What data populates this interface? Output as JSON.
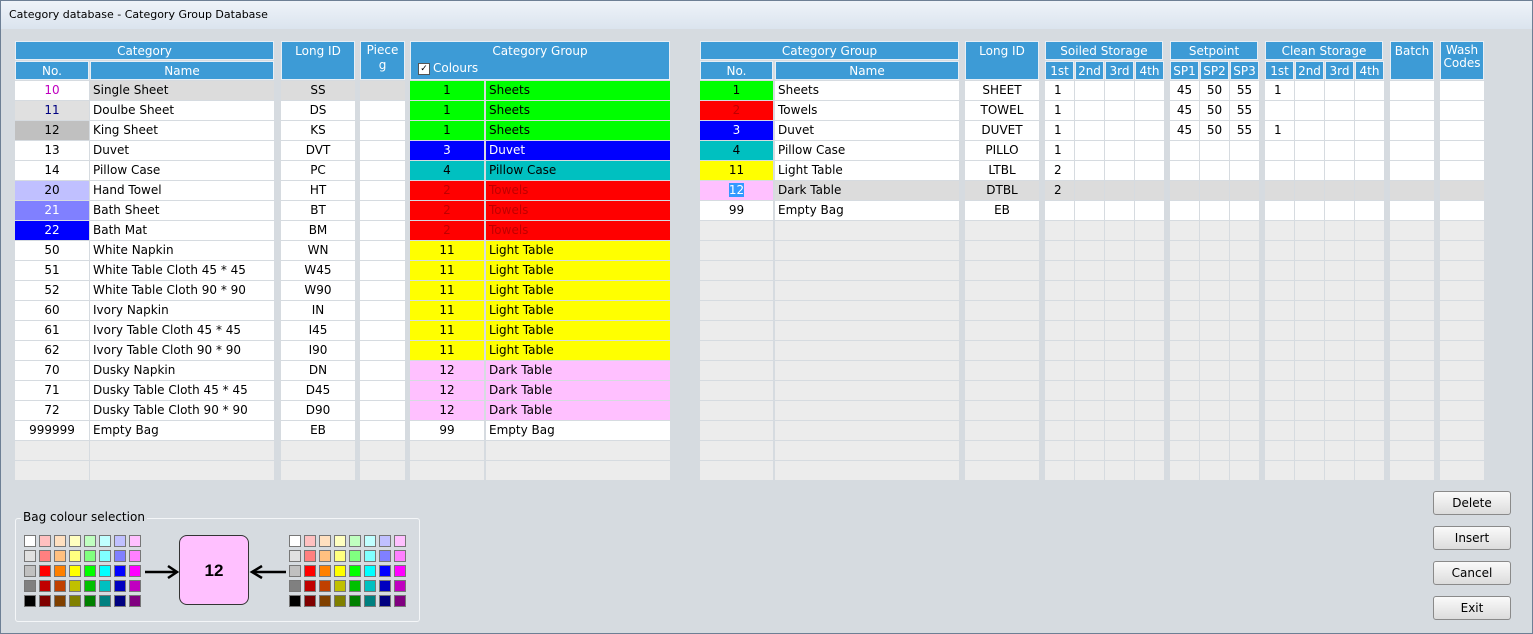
{
  "window": {
    "title": "Category database - Category Group Database"
  },
  "left_table": {
    "headers": {
      "category": "Category",
      "no": "No.",
      "name": "Name",
      "long_id": "Long ID",
      "piece": "Piece g",
      "category_group": "Category Group",
      "colours": "Colours",
      "colours_checked": true
    },
    "rows": [
      {
        "no": "10",
        "name": "Single Sheet",
        "long_id": "SS",
        "no_bg": "#ffffff",
        "no_color": "#c000c0",
        "group_no": "1",
        "group_name": "Sheets",
        "group_bg": "#00ff00",
        "group_color": "#000000",
        "selected": true
      },
      {
        "no": "11",
        "name": "Doulbe Sheet",
        "long_id": "DS",
        "no_bg": "#e0e0e0",
        "no_color": "#000080",
        "group_no": "1",
        "group_name": "Sheets",
        "group_bg": "#00ff00",
        "group_color": "#000000"
      },
      {
        "no": "12",
        "name": "King Sheet",
        "long_id": "KS",
        "no_bg": "#c0c0c0",
        "no_color": "#000000",
        "group_no": "1",
        "group_name": "Sheets",
        "group_bg": "#00ff00",
        "group_color": "#000000"
      },
      {
        "no": "13",
        "name": "Duvet",
        "long_id": "DVT",
        "no_bg": "#ffffff",
        "no_color": "#000000",
        "group_no": "3",
        "group_name": "Duvet",
        "group_bg": "#0000ff",
        "group_color": "#ffffff"
      },
      {
        "no": "14",
        "name": "Pillow Case",
        "long_id": "PC",
        "no_bg": "#ffffff",
        "no_color": "#000000",
        "group_no": "4",
        "group_name": "Pillow Case",
        "group_bg": "#00c0c0",
        "group_color": "#000000"
      },
      {
        "no": "20",
        "name": "Hand Towel",
        "long_id": "HT",
        "no_bg": "#c0c0ff",
        "no_color": "#000000",
        "group_no": "2",
        "group_name": "Towels",
        "group_bg": "#ff0000",
        "group_color": "#c00000"
      },
      {
        "no": "21",
        "name": "Bath Sheet",
        "long_id": "BT",
        "no_bg": "#8080ff",
        "no_color": "#ffffff",
        "group_no": "2",
        "group_name": "Towels",
        "group_bg": "#ff0000",
        "group_color": "#c00000"
      },
      {
        "no": "22",
        "name": "Bath Mat",
        "long_id": "BM",
        "no_bg": "#0000ff",
        "no_color": "#ffffff",
        "group_no": "2",
        "group_name": "Towels",
        "group_bg": "#ff0000",
        "group_color": "#c00000"
      },
      {
        "no": "50",
        "name": "White Napkin",
        "long_id": "WN",
        "no_bg": "#ffffff",
        "no_color": "#000000",
        "group_no": "11",
        "group_name": "Light Table",
        "group_bg": "#ffff00",
        "group_color": "#000000"
      },
      {
        "no": "51",
        "name": "White Table Cloth 45 * 45",
        "long_id": "W45",
        "no_bg": "#ffffff",
        "no_color": "#000000",
        "group_no": "11",
        "group_name": "Light Table",
        "group_bg": "#ffff00",
        "group_color": "#000000"
      },
      {
        "no": "52",
        "name": "White Table Cloth 90 * 90",
        "long_id": "W90",
        "no_bg": "#ffffff",
        "no_color": "#000000",
        "group_no": "11",
        "group_name": "Light Table",
        "group_bg": "#ffff00",
        "group_color": "#000000"
      },
      {
        "no": "60",
        "name": "Ivory Napkin",
        "long_id": "IN",
        "no_bg": "#ffffff",
        "no_color": "#000000",
        "group_no": "11",
        "group_name": "Light Table",
        "group_bg": "#ffff00",
        "group_color": "#000000"
      },
      {
        "no": "61",
        "name": "Ivory Table Cloth 45 * 45",
        "long_id": "I45",
        "no_bg": "#ffffff",
        "no_color": "#000000",
        "group_no": "11",
        "group_name": "Light Table",
        "group_bg": "#ffff00",
        "group_color": "#000000"
      },
      {
        "no": "62",
        "name": "Ivory Table Cloth 90 * 90",
        "long_id": "I90",
        "no_bg": "#ffffff",
        "no_color": "#000000",
        "group_no": "11",
        "group_name": "Light Table",
        "group_bg": "#ffff00",
        "group_color": "#000000"
      },
      {
        "no": "70",
        "name": "Dusky Napkin",
        "long_id": "DN",
        "no_bg": "#ffffff",
        "no_color": "#000000",
        "group_no": "12",
        "group_name": "Dark Table",
        "group_bg": "#ffc0ff",
        "group_color": "#000000"
      },
      {
        "no": "71",
        "name": "Dusky Table Cloth 45 * 45",
        "long_id": "D45",
        "no_bg": "#ffffff",
        "no_color": "#000000",
        "group_no": "12",
        "group_name": "Dark Table",
        "group_bg": "#ffc0ff",
        "group_color": "#000000"
      },
      {
        "no": "72",
        "name": "Dusky Table Cloth 90 * 90",
        "long_id": "D90",
        "no_bg": "#ffffff",
        "no_color": "#000000",
        "group_no": "12",
        "group_name": "Dark Table",
        "group_bg": "#ffc0ff",
        "group_color": "#000000"
      },
      {
        "no": "999999",
        "name": "Empty Bag",
        "long_id": "EB",
        "no_bg": "#ffffff",
        "no_color": "#000000",
        "group_no": "99",
        "group_name": "Empty Bag",
        "group_bg": "#ffffff",
        "group_color": "#000000"
      }
    ]
  },
  "right_table": {
    "headers": {
      "category_group": "Category Group",
      "no": "No.",
      "name": "Name",
      "long_id": "Long ID",
      "soiled_storage": "Soiled Storage",
      "setpoint": "Setpoint",
      "clean_storage": "Clean Storage",
      "batch": "Batch",
      "wash_codes": "Wash Codes",
      "s1": "1st",
      "s2": "2nd",
      "s3": "3rd",
      "s4": "4th",
      "sp1": "SP1",
      "sp2": "SP2",
      "sp3": "SP3",
      "c1": "1st",
      "c2": "2nd",
      "c3": "3rd",
      "c4": "4th"
    },
    "rows": [
      {
        "no": "1",
        "name": "Sheets",
        "long_id": "SHEET",
        "no_bg": "#00ff00",
        "no_color": "#000000",
        "soiled": [
          "1",
          "",
          "",
          ""
        ],
        "setpoint": [
          "45",
          "50",
          "55"
        ],
        "clean": [
          "1",
          "",
          "",
          ""
        ],
        "batch": "",
        "wash": ""
      },
      {
        "no": "2",
        "name": "Towels",
        "long_id": "TOWEL",
        "no_bg": "#ff0000",
        "no_color": "#c00000",
        "soiled": [
          "1",
          "",
          "",
          ""
        ],
        "setpoint": [
          "45",
          "50",
          "55"
        ],
        "clean": [
          "",
          "",
          "",
          ""
        ],
        "batch": "",
        "wash": ""
      },
      {
        "no": "3",
        "name": "Duvet",
        "long_id": "DUVET",
        "no_bg": "#0000ff",
        "no_color": "#ffffff",
        "soiled": [
          "1",
          "",
          "",
          ""
        ],
        "setpoint": [
          "45",
          "50",
          "55"
        ],
        "clean": [
          "1",
          "",
          "",
          ""
        ],
        "batch": "",
        "wash": ""
      },
      {
        "no": "4",
        "name": "Pillow Case",
        "long_id": "PILLO",
        "no_bg": "#00c0c0",
        "no_color": "#000000",
        "soiled": [
          "1",
          "",
          "",
          ""
        ],
        "setpoint": [
          "",
          "",
          ""
        ],
        "clean": [
          "",
          "",
          "",
          ""
        ],
        "batch": "",
        "wash": ""
      },
      {
        "no": "11",
        "name": "Light Table",
        "long_id": "LTBL",
        "no_bg": "#ffff00",
        "no_color": "#000000",
        "soiled": [
          "2",
          "",
          "",
          ""
        ],
        "setpoint": [
          "",
          "",
          ""
        ],
        "clean": [
          "",
          "",
          "",
          ""
        ],
        "batch": "",
        "wash": ""
      },
      {
        "no": "12",
        "name": "Dark Table",
        "long_id": "DTBL",
        "no_bg": "#ffc0ff",
        "no_color": "#000000",
        "soiled": [
          "2",
          "",
          "",
          ""
        ],
        "setpoint": [
          "",
          "",
          ""
        ],
        "clean": [
          "",
          "",
          "",
          ""
        ],
        "batch": "",
        "wash": "",
        "selected": true
      },
      {
        "no": "99",
        "name": "Empty Bag",
        "long_id": "EB",
        "no_bg": "#ffffff",
        "no_color": "#000000",
        "soiled": [
          "",
          "",
          "",
          ""
        ],
        "setpoint": [
          "",
          "",
          ""
        ],
        "clean": [
          "",
          "",
          "",
          ""
        ],
        "batch": "",
        "wash": ""
      }
    ]
  },
  "bag_colour": {
    "label": "Bag colour selection",
    "selected_value": "12",
    "selected_color": "#ffc0ff",
    "palette": [
      [
        "#ffffff",
        "#ffc0c0",
        "#ffe0c0",
        "#ffffc0",
        "#c0ffc0",
        "#c0ffff",
        "#c0c0ff",
        "#ffc0ff"
      ],
      [
        "#e0e0e0",
        "#ff8080",
        "#ffc080",
        "#ffff80",
        "#80ff80",
        "#80ffff",
        "#8080ff",
        "#ff80ff"
      ],
      [
        "#c0c0c0",
        "#ff0000",
        "#ff8000",
        "#ffff00",
        "#00ff00",
        "#00ffff",
        "#0000ff",
        "#ff00ff"
      ],
      [
        "#808080",
        "#c00000",
        "#c04000",
        "#c0c000",
        "#00c000",
        "#00c0c0",
        "#0000c0",
        "#c000c0"
      ],
      [
        "#000000",
        "#800000",
        "#804000",
        "#808000",
        "#008000",
        "#008080",
        "#000080",
        "#800080"
      ]
    ]
  },
  "buttons": {
    "delete": "Delete",
    "insert": "Insert",
    "cancel": "Cancel",
    "exit": "Exit"
  }
}
